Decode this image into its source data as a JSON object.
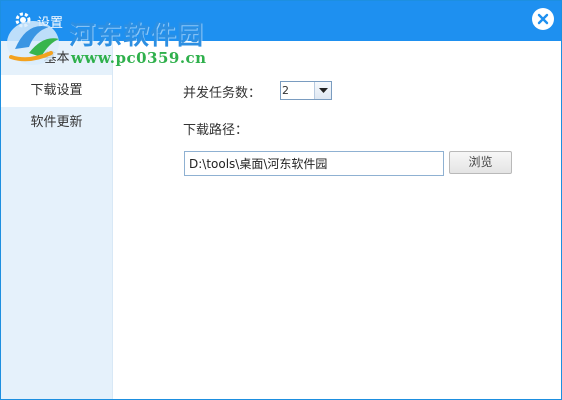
{
  "window": {
    "title": "设置"
  },
  "watermark": {
    "site_name": "河东软件园",
    "url": "www.pc0359.cn"
  },
  "sidebar": {
    "items": [
      {
        "label": "基本",
        "active": false
      },
      {
        "label": "下载设置",
        "active": true
      },
      {
        "label": "软件更新",
        "active": false
      }
    ]
  },
  "download_settings": {
    "concurrency_label": "并发任务数：",
    "concurrency_value": "2",
    "path_label": "下载路径：",
    "path_value": "D:\\tools\\桌面\\河东软件园",
    "browse_label": "浏览"
  },
  "colors": {
    "titlebar": "#1e90f0",
    "sidebar_bg": "#e5f1fb",
    "watermark_text": "#2d8fe2",
    "watermark_url": "#2fb04c"
  },
  "icons": {
    "title_icon": "gear-icon",
    "close_icon": "close-icon",
    "dropdown_icon": "triangle-down-icon",
    "logo_icon": "logo-icon"
  }
}
